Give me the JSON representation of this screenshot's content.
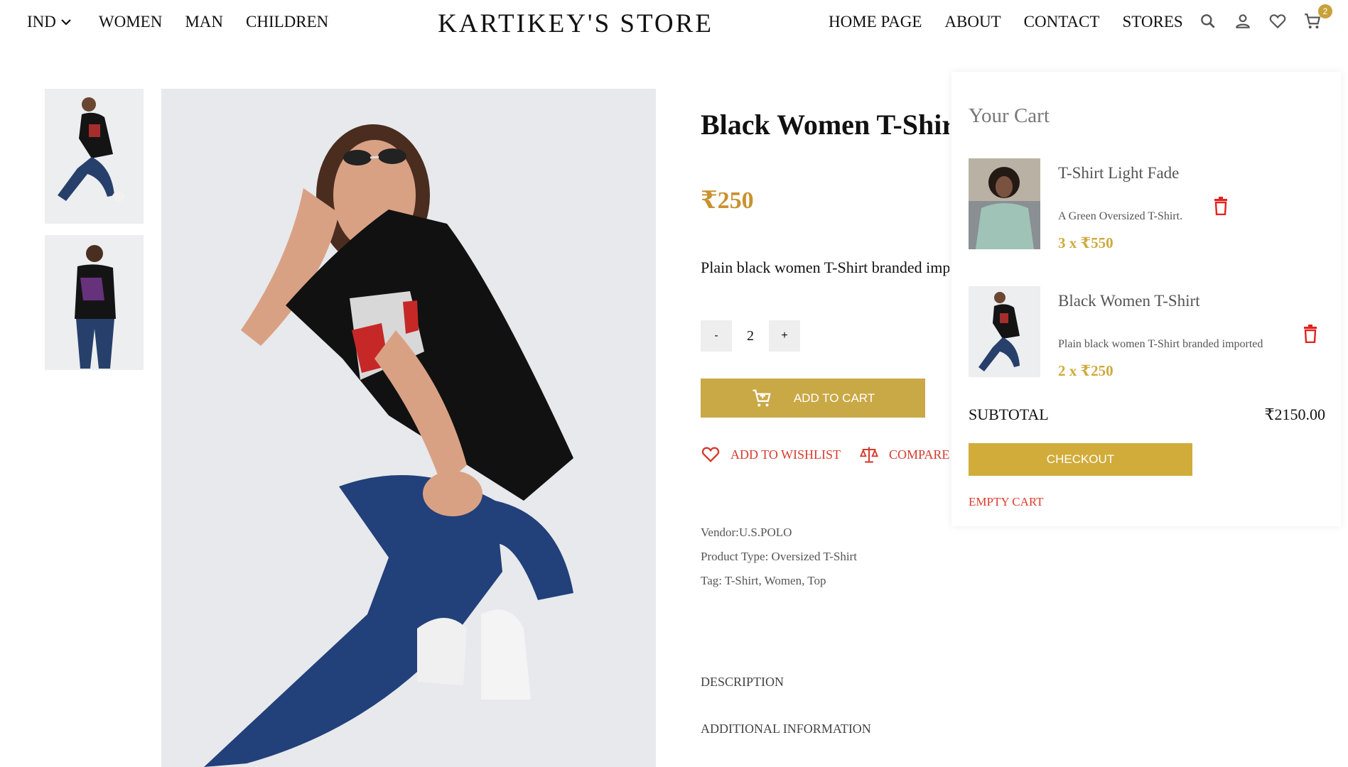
{
  "header": {
    "locale": "IND",
    "nav_left": [
      "WOMEN",
      "MAN",
      "CHILDREN"
    ],
    "brand": "KARTIKEY'S STORE",
    "nav_right": [
      "HOME PAGE",
      "ABOUT",
      "CONTACT",
      "STORES"
    ],
    "icons": [
      "search-icon",
      "account-icon",
      "heart-icon",
      "cart-icon"
    ],
    "cart_count": "2"
  },
  "product": {
    "title": "Black Women T-Shirt",
    "price": "₹250",
    "description": "Plain black women T-Shirt branded imported",
    "quantity": "2",
    "minus": "-",
    "plus": "+",
    "add_to_cart": "ADD TO CART",
    "wishlist": "ADD TO WISHLIST",
    "compare": "COMPARE",
    "vendor": "Vendor:U.S.POLO",
    "product_type": "Product Type: Oversized T-Shirt",
    "tags": "Tag: T-Shirt, Women, Top",
    "tab_description": "DESCRIPTION",
    "tab_additional": "ADDITIONAL INFORMATION"
  },
  "cart": {
    "title": "Your Cart",
    "items": [
      {
        "name": "T-Shirt Light Fade",
        "description": "A Green Oversized T-Shirt.",
        "price": "3 x ₹550"
      },
      {
        "name": "Black Women T-Shirt",
        "description": "Plain black women T-Shirt branded imported",
        "price": "2 x ₹250"
      }
    ],
    "subtotal_label": "SUBTOTAL",
    "subtotal_value": "₹2150.00",
    "checkout": "CHECKOUT",
    "empty": "EMPTY CART"
  },
  "colors": {
    "accent_gold": "#c9a846",
    "price_gold": "#c8922f",
    "action_red": "#d63a2e"
  }
}
